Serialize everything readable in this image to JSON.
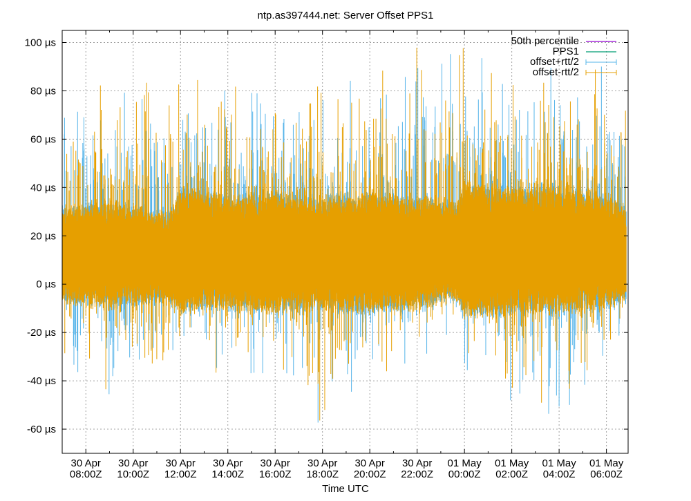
{
  "chart_data": {
    "type": "line",
    "title": "ntp.as397444.net: Server Offset PPS1",
    "xlabel": "Time UTC",
    "ylabel": "",
    "ylim": [
      -70,
      105
    ],
    "xlim": [
      "2023-04-30T07:00Z",
      "2023-05-01T06:55Z"
    ],
    "grid": true,
    "legend_position": "top-right",
    "y_ticks": [
      {
        "value": 100,
        "label": "100 µs"
      },
      {
        "value": 80,
        "label": "80 µs"
      },
      {
        "value": 60,
        "label": "60 µs"
      },
      {
        "value": 40,
        "label": "40 µs"
      },
      {
        "value": 20,
        "label": "20 µs"
      },
      {
        "value": 0,
        "label": "0 µs"
      },
      {
        "value": -20,
        "label": "-20 µs"
      },
      {
        "value": -40,
        "label": "-40 µs"
      },
      {
        "value": -60,
        "label": "-60 µs"
      }
    ],
    "x_ticks": [
      {
        "value": "2023-04-30T08:00Z",
        "date": "30 Apr",
        "time": "08:00Z"
      },
      {
        "value": "2023-04-30T10:00Z",
        "date": "30 Apr",
        "time": "10:00Z"
      },
      {
        "value": "2023-04-30T12:00Z",
        "date": "30 Apr",
        "time": "12:00Z"
      },
      {
        "value": "2023-04-30T14:00Z",
        "date": "30 Apr",
        "time": "14:00Z"
      },
      {
        "value": "2023-04-30T16:00Z",
        "date": "30 Apr",
        "time": "16:00Z"
      },
      {
        "value": "2023-04-30T18:00Z",
        "date": "30 Apr",
        "time": "18:00Z"
      },
      {
        "value": "2023-04-30T20:00Z",
        "date": "30 Apr",
        "time": "20:00Z"
      },
      {
        "value": "2023-04-30T22:00Z",
        "date": "30 Apr",
        "time": "22:00Z"
      },
      {
        "value": "2023-05-01T00:00Z",
        "date": "01 May",
        "time": "00:00Z"
      },
      {
        "value": "2023-05-01T02:00Z",
        "date": "01 May",
        "time": "02:00Z"
      },
      {
        "value": "2023-05-01T04:00Z",
        "date": "01 May",
        "time": "04:00Z"
      },
      {
        "value": "2023-05-01T06:00Z",
        "date": "01 May",
        "time": "06:00Z"
      }
    ],
    "series": [
      {
        "name": "50th percentile",
        "color": "#9400d3",
        "style": "line"
      },
      {
        "name": "PPS1",
        "color": "#009e73",
        "style": "line"
      },
      {
        "name": "offset+rtt/2",
        "color": "#56b4e9",
        "style": "error-band",
        "note": "drawn underneath and fully covered by offset-rtt/2 band"
      },
      {
        "name": "offset-rtt/2",
        "color": "#e69f00",
        "style": "error-band",
        "x": [
          "2023-04-30T07:00Z",
          "2023-04-30T09:00Z",
          "2023-04-30T11:30Z",
          "2023-04-30T12:00Z",
          "2023-04-30T14:00Z",
          "2023-04-30T16:00Z",
          "2023-04-30T18:00Z",
          "2023-04-30T20:00Z",
          "2023-04-30T22:00Z",
          "2023-04-30T23:40Z",
          "2023-05-01T00:00Z",
          "2023-05-01T02:00Z",
          "2023-05-01T04:00Z",
          "2023-05-01T05:50Z",
          "2023-05-01T06:50Z"
        ],
        "band_low": [
          -5,
          -8,
          -5,
          -10,
          -8,
          -10,
          -8,
          -10,
          -8,
          -5,
          -12,
          -10,
          -10,
          -8,
          -5
        ],
        "band_high": [
          30,
          32,
          28,
          38,
          35,
          36,
          34,
          36,
          34,
          32,
          40,
          38,
          38,
          36,
          30
        ],
        "spike_max": [
          87,
          88,
          89,
          102,
          87,
          91,
          86,
          89,
          103,
          104,
          101,
          96,
          91,
          93,
          89
        ],
        "spike_min": [
          -33,
          -52,
          -49,
          -35,
          -40,
          -47,
          -70,
          -43,
          -37,
          -28,
          -44,
          -55,
          -63,
          -42,
          -25
        ]
      }
    ]
  }
}
